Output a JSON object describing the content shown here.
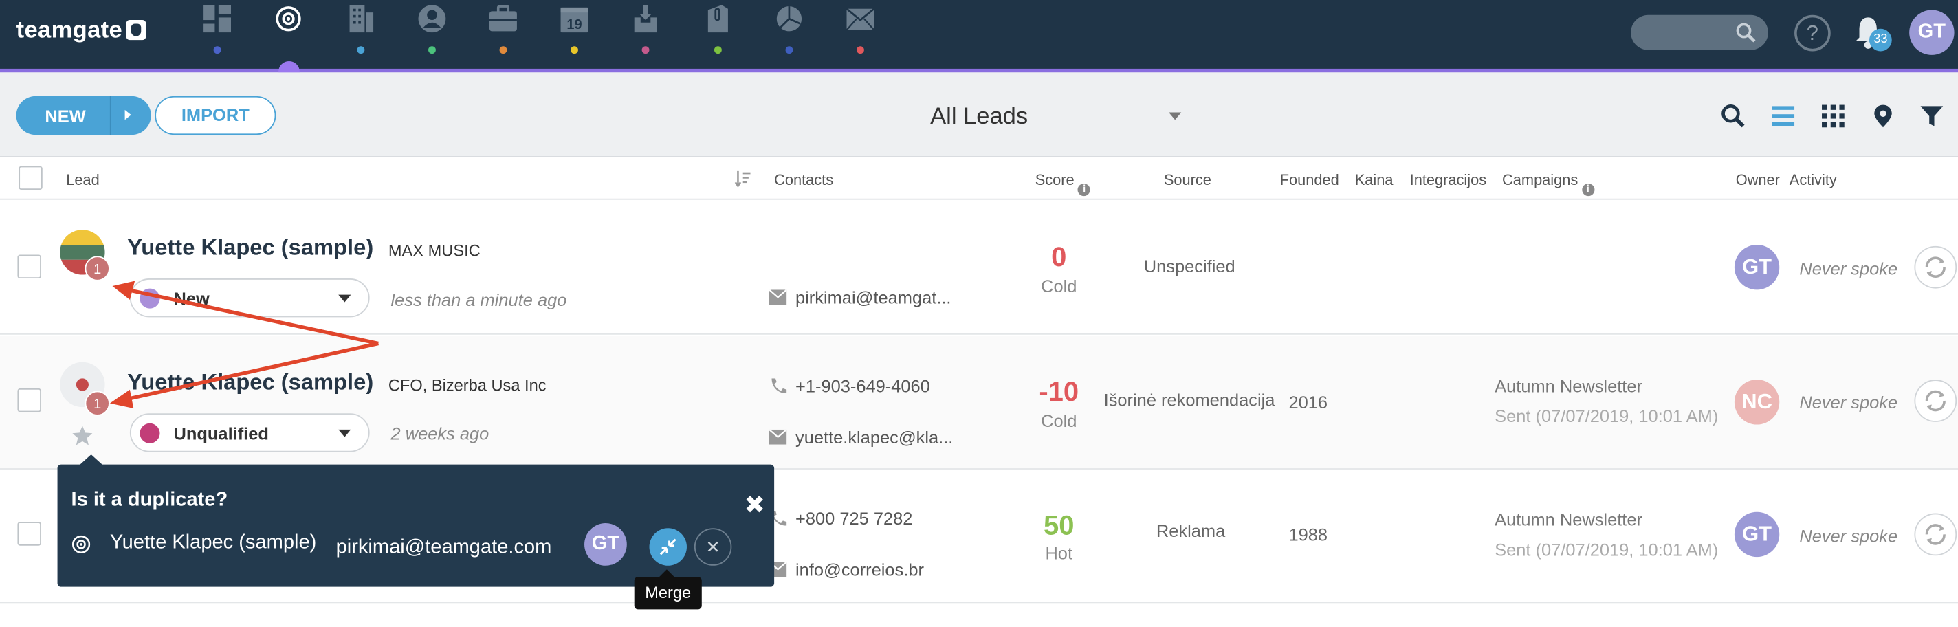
{
  "app": {
    "logo": "teamgate"
  },
  "nav": {
    "items": [
      {
        "name": "dashboard",
        "dot": "#4b63c9"
      },
      {
        "name": "leads",
        "dot": "#9b78ef"
      },
      {
        "name": "companies",
        "dot": "#4aa3d6"
      },
      {
        "name": "people",
        "dot": "#4cc37d"
      },
      {
        "name": "deals",
        "dot": "#e08a3c"
      },
      {
        "name": "calendar",
        "dot": "#e8c62a"
      },
      {
        "name": "inbox",
        "dot": "#c45a8c"
      },
      {
        "name": "documents",
        "dot": "#7ec240"
      },
      {
        "name": "reports",
        "dot": "#3f5fbf"
      },
      {
        "name": "mail",
        "dot": "#e0585c"
      }
    ],
    "calendar_day": "19"
  },
  "header": {
    "help_label": "?",
    "notifications_count": "33",
    "user_initials": "GT"
  },
  "toolbar": {
    "new_label": "NEW",
    "import_label": "IMPORT",
    "view_title": "All Leads"
  },
  "table": {
    "columns": {
      "lead": "Lead",
      "contacts": "Contacts",
      "score": "Score",
      "source": "Source",
      "founded": "Founded",
      "kaina": "Kaina",
      "integracijos": "Integracijos",
      "campaigns": "Campaigns",
      "owner": "Owner",
      "activity": "Activity"
    },
    "rows": [
      {
        "name": "Yuette Klapec (sample)",
        "company": "MAX MUSIC",
        "status": "New",
        "status_color": "#a98fd9",
        "ago": "less than a minute ago",
        "phone": "",
        "email": "pirkimai@teamgat...",
        "score": "0",
        "score_label": "Cold",
        "source": "Unspecified",
        "founded": "",
        "campaign": "",
        "campaign_sent": "",
        "owner": "GT",
        "owner_color": "#9b9ad6",
        "activity": "Never spoke",
        "duplicates": "1"
      },
      {
        "name": "Yuette Klapec (sample)",
        "company": "CFO, Bizerba Usa Inc",
        "status": "Unqualified",
        "status_color": "#c23d78",
        "ago": "2 weeks ago",
        "phone": "+1-903-649-4060",
        "email": "yuette.klapec@kla...",
        "score": "-10",
        "score_label": "Cold",
        "source": "Išorinė rekomendacija",
        "founded": "2016",
        "campaign": "Autumn Newsletter",
        "campaign_sent": "Sent (07/07/2019, 10:01 AM)",
        "owner": "NC",
        "owner_color": "#ecb7b5",
        "activity": "Never spoke",
        "duplicates": "1"
      },
      {
        "name": "",
        "company": "",
        "status": "",
        "ago": "",
        "phone": "+800 725 7282",
        "email": "info@correios.br",
        "score": "50",
        "score_label": "Hot",
        "source": "Reklama",
        "founded": "1988",
        "campaign": "Autumn Newsletter",
        "campaign_sent": "Sent (07/07/2019, 10:01 AM)",
        "owner": "GT",
        "owner_color": "#9b9ad6",
        "activity": "Never spoke"
      }
    ]
  },
  "duplicate_popup": {
    "title": "Is it a duplicate?",
    "match_name": "Yuette Klapec (sample)",
    "match_email": "pirkimai@teamgate.com",
    "owner_initials": "GT",
    "merge_tooltip": "Merge",
    "close_label": "✖",
    "dismiss_label": "✕"
  },
  "colors": {
    "topbar": "#1f3447",
    "accent": "#4aa3d6",
    "score_cold": "#e0585c",
    "score_hot": "#8cc152"
  }
}
